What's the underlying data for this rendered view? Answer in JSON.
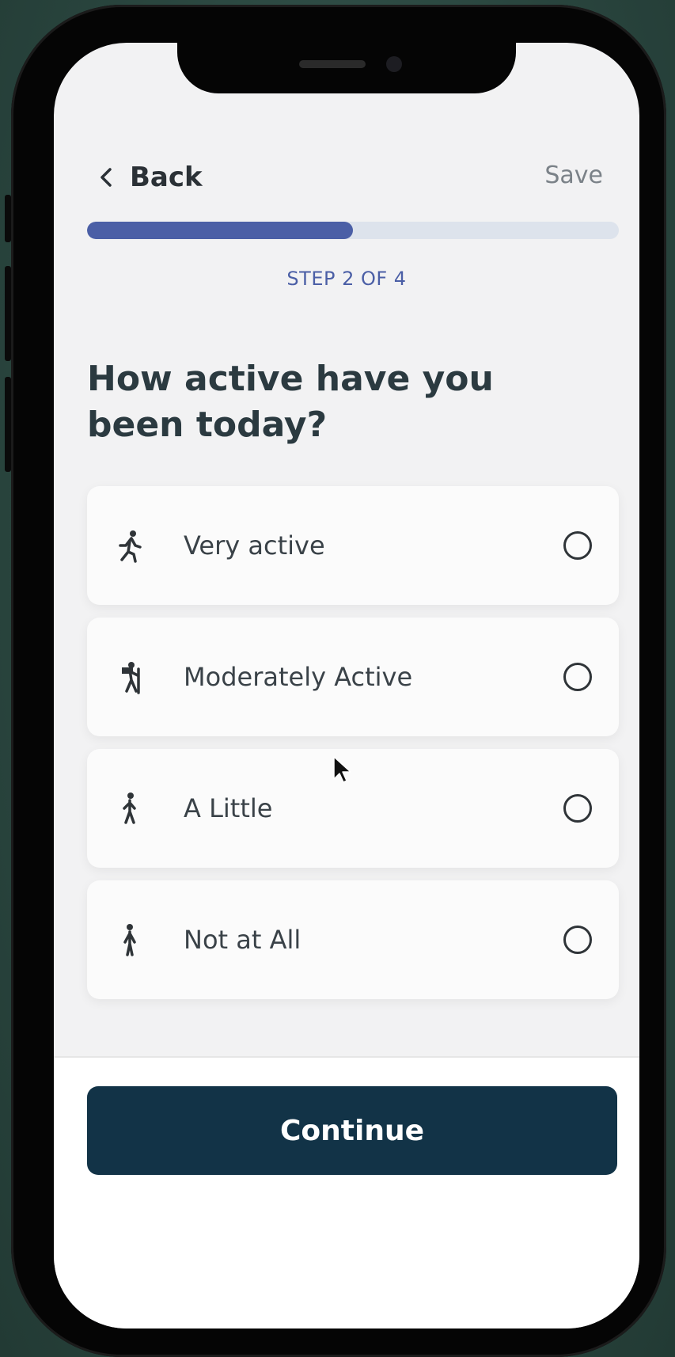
{
  "header": {
    "back_label": "Back",
    "save_label": "Save"
  },
  "progress": {
    "fraction": 0.5,
    "step_label": "STEP 2 OF 4"
  },
  "question": "How active have you been today?",
  "options": [
    {
      "label": "Very active",
      "icon": "running-person-icon",
      "selected": false
    },
    {
      "label": "Moderately Active",
      "icon": "hiking-person-icon",
      "selected": false
    },
    {
      "label": "A Little",
      "icon": "walking-person-icon",
      "selected": false
    },
    {
      "label": "Not at All",
      "icon": "standing-person-icon",
      "selected": false
    }
  ],
  "footer": {
    "continue_label": "Continue"
  },
  "colors": {
    "accent": "#4b5fa6",
    "progress_track": "#dde3ec",
    "continue_button": "#123347",
    "screen_background": "#f2f2f3"
  }
}
